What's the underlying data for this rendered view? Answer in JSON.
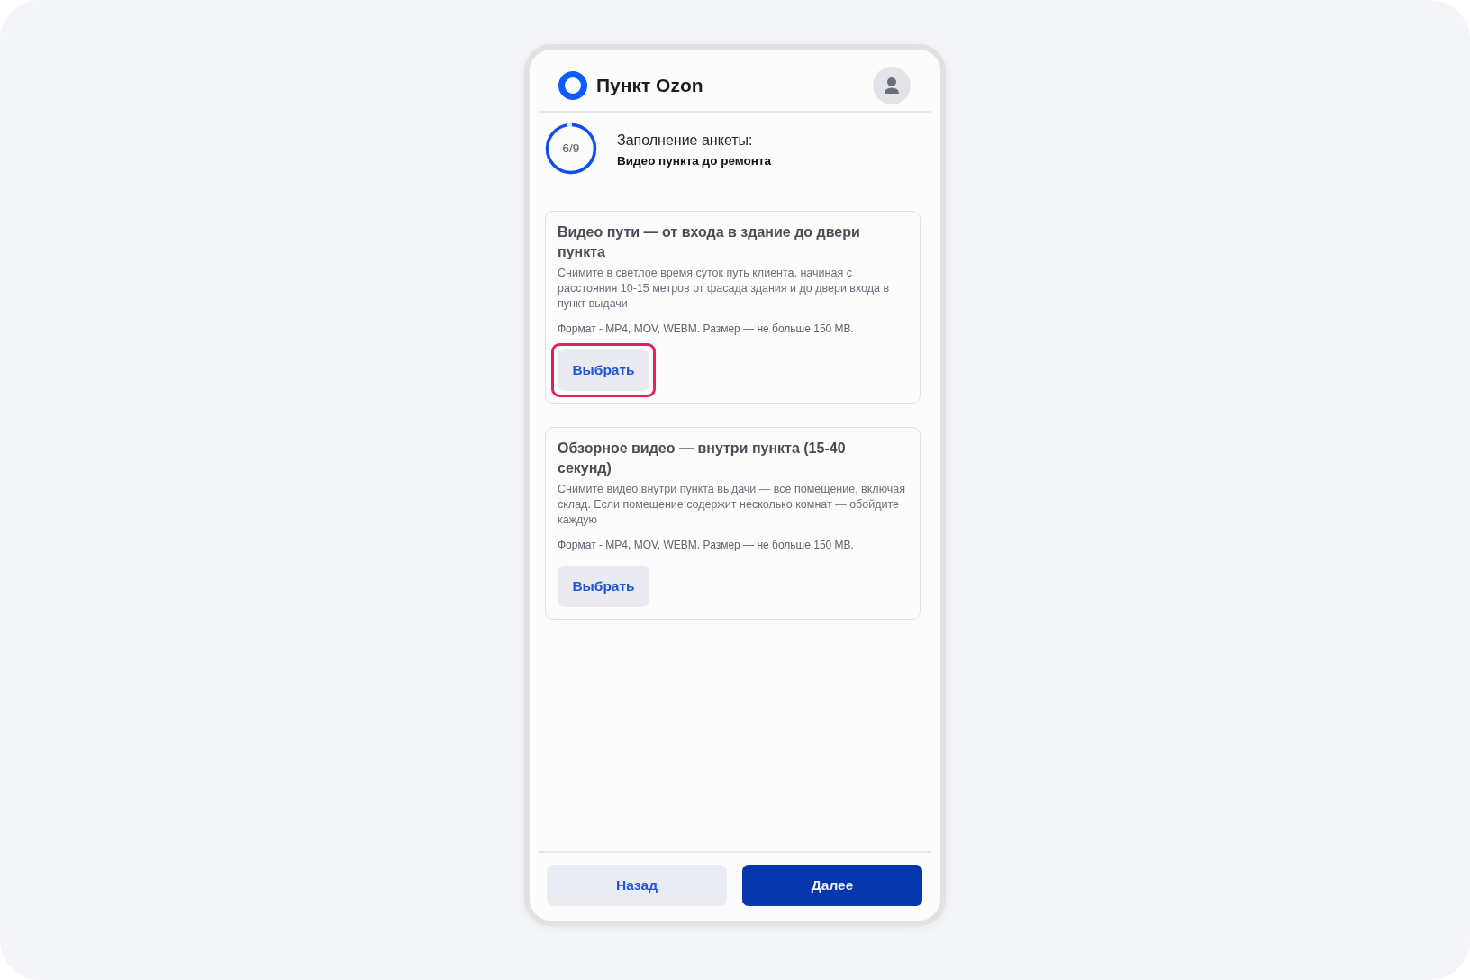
{
  "header": {
    "title": "Пункт Ozon"
  },
  "progress": {
    "counter": "6/9",
    "level": 0.96,
    "label": "Заполнение анкеты:",
    "step": "Видео пункта до ремонта"
  },
  "cards": [
    {
      "title": "Видео пути — от входа в здание до двери пункта",
      "description": "Снимите в светлое время суток путь клиента, начиная с расстояния 10-15 метров от фасада здания и до двери входа в пункт выдачи",
      "format": "Формат - MP4, MOV, WEBM. Размер — не больше 150 MB.",
      "button": "Выбрать",
      "highlighted": true
    },
    {
      "title": "Обзорное видео — внутри пункта (15-40 секунд)",
      "description": "Снимите видео внутри пункта выдачи — всё помещение, включая склад. Если помещение содержит несколько комнат — обойдите каждую",
      "format": "Формат - MP4, MOV, WEBM. Размер — не больше 150 MB.",
      "button": "Выбрать",
      "highlighted": false
    }
  ],
  "footer": {
    "buttons": [
      {
        "label": "Назад",
        "kind": "secondary"
      },
      {
        "label": "Далее",
        "kind": "primary"
      }
    ]
  }
}
